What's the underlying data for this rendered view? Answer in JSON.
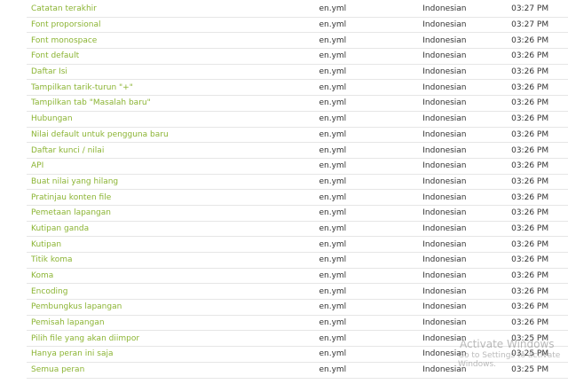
{
  "colors": {
    "key_link": "#8bb433",
    "text": "#333333",
    "row_border": "#e6e6e6",
    "watermark": "#828282"
  },
  "rows": [
    {
      "key": "Catatan terakhir",
      "file": "en.yml",
      "language": "Indonesian",
      "time": "03:27 PM"
    },
    {
      "key": "Font proporsional",
      "file": "en.yml",
      "language": "Indonesian",
      "time": "03:27 PM"
    },
    {
      "key": "Font monospace",
      "file": "en.yml",
      "language": "Indonesian",
      "time": "03:26 PM"
    },
    {
      "key": "Font default",
      "file": "en.yml",
      "language": "Indonesian",
      "time": "03:26 PM"
    },
    {
      "key": "Daftar Isi",
      "file": "en.yml",
      "language": "Indonesian",
      "time": "03:26 PM"
    },
    {
      "key": "Tampilkan tarik-turun \"+\"",
      "file": "en.yml",
      "language": "Indonesian",
      "time": "03:26 PM"
    },
    {
      "key": "Tampilkan tab \"Masalah baru\"",
      "file": "en.yml",
      "language": "Indonesian",
      "time": "03:26 PM"
    },
    {
      "key": "Hubungan",
      "file": "en.yml",
      "language": "Indonesian",
      "time": "03:26 PM"
    },
    {
      "key": "Nilai default untuk pengguna baru",
      "file": "en.yml",
      "language": "Indonesian",
      "time": "03:26 PM"
    },
    {
      "key": "Daftar kunci / nilai",
      "file": "en.yml",
      "language": "Indonesian",
      "time": "03:26 PM"
    },
    {
      "key": "API",
      "file": "en.yml",
      "language": "Indonesian",
      "time": "03:26 PM"
    },
    {
      "key": "Buat nilai yang hilang",
      "file": "en.yml",
      "language": "Indonesian",
      "time": "03:26 PM"
    },
    {
      "key": "Pratinjau konten file",
      "file": "en.yml",
      "language": "Indonesian",
      "time": "03:26 PM"
    },
    {
      "key": "Pemetaan lapangan",
      "file": "en.yml",
      "language": "Indonesian",
      "time": "03:26 PM"
    },
    {
      "key": "Kutipan ganda",
      "file": "en.yml",
      "language": "Indonesian",
      "time": "03:26 PM"
    },
    {
      "key": "Kutipan",
      "file": "en.yml",
      "language": "Indonesian",
      "time": "03:26 PM"
    },
    {
      "key": "Titik koma",
      "file": "en.yml",
      "language": "Indonesian",
      "time": "03:26 PM"
    },
    {
      "key": "Koma",
      "file": "en.yml",
      "language": "Indonesian",
      "time": "03:26 PM"
    },
    {
      "key": "Encoding",
      "file": "en.yml",
      "language": "Indonesian",
      "time": "03:26 PM"
    },
    {
      "key": "Pembungkus lapangan",
      "file": "en.yml",
      "language": "Indonesian",
      "time": "03:26 PM"
    },
    {
      "key": "Pemisah lapangan",
      "file": "en.yml",
      "language": "Indonesian",
      "time": "03:26 PM"
    },
    {
      "key": "Pilih file yang akan diimpor",
      "file": "en.yml",
      "language": "Indonesian",
      "time": "03:25 PM"
    },
    {
      "key": "Hanya peran ini saja",
      "file": "en.yml",
      "language": "Indonesian",
      "time": "03:25 PM"
    },
    {
      "key": "Semua peran",
      "file": "en.yml",
      "language": "Indonesian",
      "time": "03:25 PM"
    }
  ],
  "watermark": {
    "title": "Activate Windows",
    "subtitle": "Go to Settings to activate Windows."
  }
}
